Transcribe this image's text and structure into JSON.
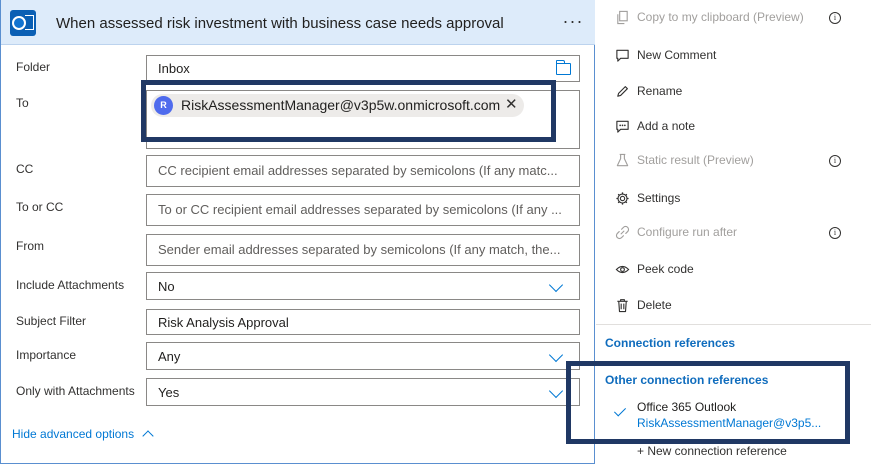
{
  "card": {
    "title": "When assessed risk investment with business case needs approval",
    "more_label": "···"
  },
  "fields": {
    "folder": {
      "label": "Folder",
      "value": "Inbox"
    },
    "to": {
      "label": "To",
      "token_initial": "R",
      "token_value": "RiskAssessmentManager@v3p5w.onmicrosoft.com",
      "remove": "✕"
    },
    "cc": {
      "label": "CC",
      "placeholder": "CC recipient email addresses separated by semicolons (If any matc..."
    },
    "to_or_cc": {
      "label": "To or CC",
      "placeholder": "To or CC recipient email addresses separated by semicolons (If any ..."
    },
    "from": {
      "label": "From",
      "placeholder": "Sender email addresses separated by semicolons (If any match, the..."
    },
    "include_attachments": {
      "label": "Include Attachments",
      "value": "No"
    },
    "subject_filter": {
      "label": "Subject Filter",
      "value": "Risk Analysis Approval"
    },
    "importance": {
      "label": "Importance",
      "value": "Any"
    },
    "only_with_attachments": {
      "label": "Only with Attachments",
      "value": "Yes"
    }
  },
  "hide_advanced": "Hide advanced options",
  "menu": {
    "copy": "Copy to my clipboard (Preview)",
    "new_comment": "New Comment",
    "rename": "Rename",
    "add_note": "Add a note",
    "static_result": "Static result (Preview)",
    "settings": "Settings",
    "configure_run_after": "Configure run after",
    "peek_code": "Peek code",
    "delete": "Delete",
    "info": "i"
  },
  "connections": {
    "title": "Connection references",
    "other_title": "Other connection references",
    "name": "Office 365 Outlook",
    "account": "RiskAssessmentManager@v3p5...",
    "new_reference": "+ New connection reference"
  },
  "colors": {
    "accent": "#0078d4",
    "header_bg": "#ddebfa",
    "highlight_border": "#203864"
  }
}
